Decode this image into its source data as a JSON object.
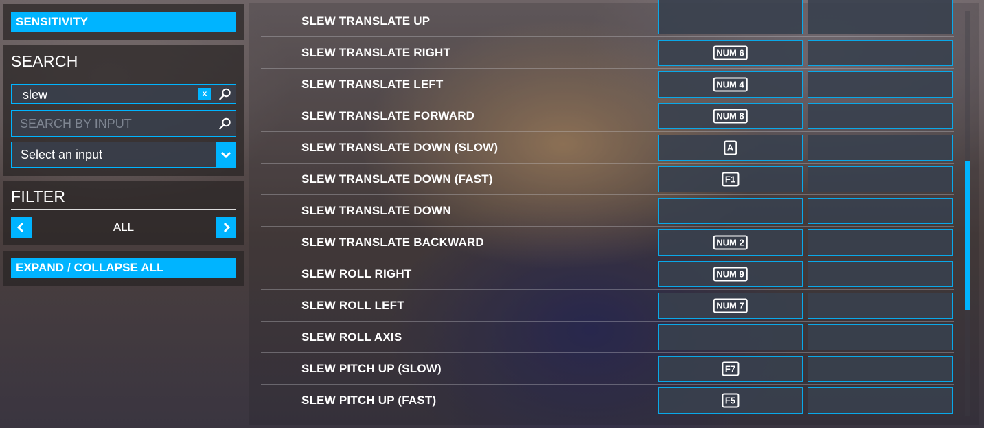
{
  "left": {
    "sensitivity_label": "SENSITIVITY",
    "search": {
      "title": "SEARCH",
      "query": "slew",
      "clear_label": "x",
      "input_placeholder": "SEARCH BY INPUT",
      "select_value": "Select an input"
    },
    "filter": {
      "title": "FILTER",
      "value": "ALL"
    },
    "expand_label": "EXPAND / COLLAPSE ALL"
  },
  "bindings": [
    {
      "label": "SLEW TRANSLATE UP",
      "key1": "",
      "key2": ""
    },
    {
      "label": "SLEW TRANSLATE RIGHT",
      "key1": "NUM 6",
      "key2": ""
    },
    {
      "label": "SLEW TRANSLATE LEFT",
      "key1": "NUM 4",
      "key2": ""
    },
    {
      "label": "SLEW TRANSLATE FORWARD",
      "key1": "NUM 8",
      "key2": ""
    },
    {
      "label": "SLEW TRANSLATE DOWN (SLOW)",
      "key1": "A",
      "key2": ""
    },
    {
      "label": "SLEW TRANSLATE DOWN (FAST)",
      "key1": "F1",
      "key2": ""
    },
    {
      "label": "SLEW TRANSLATE DOWN",
      "key1": "",
      "key2": ""
    },
    {
      "label": "SLEW TRANSLATE BACKWARD",
      "key1": "NUM 2",
      "key2": ""
    },
    {
      "label": "SLEW ROLL RIGHT",
      "key1": "NUM 9",
      "key2": ""
    },
    {
      "label": "SLEW ROLL LEFT",
      "key1": "NUM 7",
      "key2": ""
    },
    {
      "label": "SLEW ROLL AXIS",
      "key1": "",
      "key2": ""
    },
    {
      "label": "SLEW PITCH UP (SLOW)",
      "key1": "F7",
      "key2": ""
    },
    {
      "label": "SLEW PITCH UP (FAST)",
      "key1": "F5",
      "key2": ""
    }
  ],
  "icons": {
    "search": "magnifier-icon",
    "clear": "clear-x-icon",
    "dropdown": "chevron-down-icon",
    "prev": "chevron-left-icon",
    "next": "chevron-right-icon"
  },
  "colors": {
    "accent": "#00b4ff"
  }
}
